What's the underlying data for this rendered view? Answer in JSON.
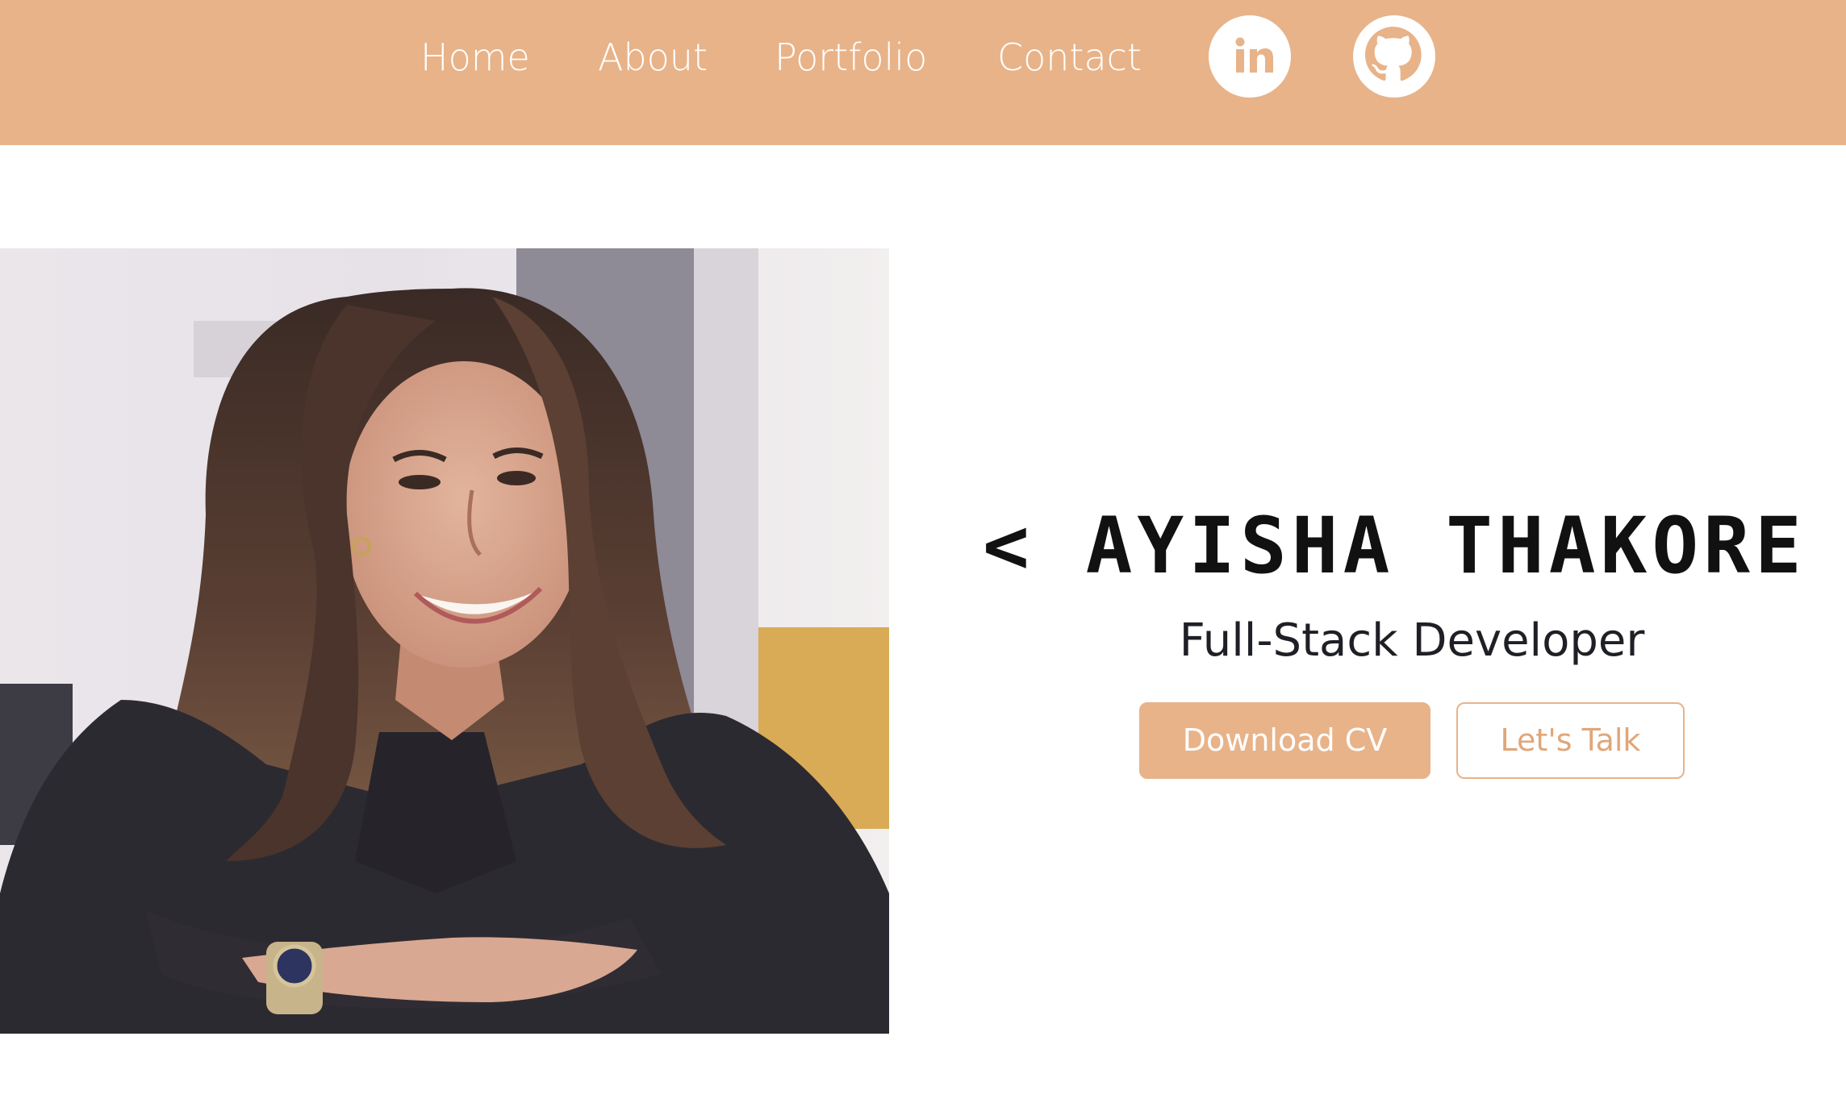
{
  "nav": {
    "items": [
      {
        "label": "Home"
      },
      {
        "label": "About"
      },
      {
        "label": "Portfolio"
      },
      {
        "label": "Contact"
      }
    ],
    "social": [
      {
        "icon": "linkedin-icon",
        "label": "in"
      },
      {
        "icon": "github-icon"
      }
    ]
  },
  "hero": {
    "name": "< AYISHA THAKORE >",
    "title": "Full-Stack Developer",
    "primary_button": "Download CV",
    "secondary_button": "Let's Talk"
  },
  "colors": {
    "accent": "#E8B389",
    "accent_text": "#E0A679",
    "background": "#FFFFFF",
    "heading": "#111111"
  }
}
